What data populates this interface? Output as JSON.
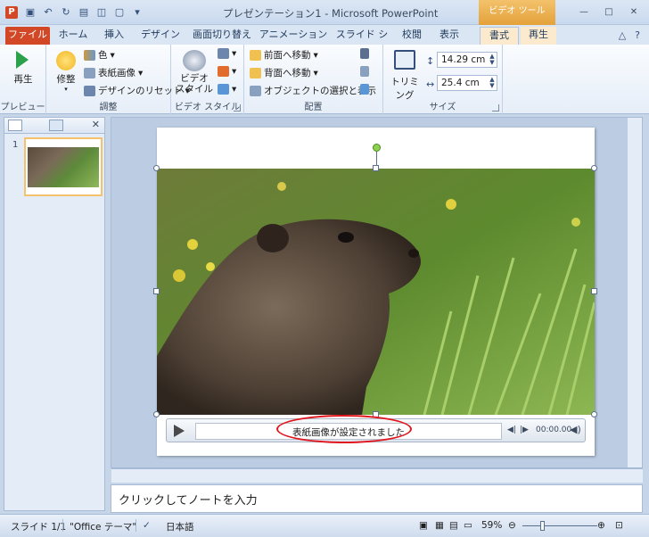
{
  "window": {
    "title": "プレゼンテーション1 - Microsoft PowerPoint",
    "app_icon_letter": "P",
    "context_tool": "ビデオ ツール",
    "controls": [
      "—",
      "□",
      "✕"
    ]
  },
  "qat_icons": [
    "save-icon",
    "undo-icon",
    "redo-icon",
    "open-icon",
    "print-preview-icon",
    "new-icon",
    "customize-icon"
  ],
  "tabs": [
    {
      "label": "ファイル"
    },
    {
      "label": "ホーム"
    },
    {
      "label": "挿入"
    },
    {
      "label": "デザイン"
    },
    {
      "label": "画面切り替え"
    },
    {
      "label": "アニメーション"
    },
    {
      "label": "スライド ショー"
    },
    {
      "label": "校閲"
    },
    {
      "label": "表示"
    },
    {
      "label": "書式"
    },
    {
      "label": "再生"
    }
  ],
  "ribbon": {
    "groups": {
      "preview": {
        "label": "プレビュー",
        "play": "再生"
      },
      "adjust": {
        "label": "調整",
        "correct": "修整",
        "color": "色",
        "poster": "表紙画像",
        "reset": "デザインのリセット"
      },
      "video_style": {
        "label": "ビデオ スタイル",
        "styles": "ビデオ スタイル"
      },
      "arrange": {
        "label": "配置",
        "forward": "前面へ移動",
        "backward": "背面へ移動",
        "selection": "オブジェクトの選択と表示"
      },
      "size": {
        "label": "サイズ",
        "crop": "トリミング",
        "height": "14.29 cm",
        "width": "25.4 cm"
      }
    }
  },
  "slides_pane": {
    "slide_number": "1"
  },
  "player": {
    "status": "表紙画像が設定されました",
    "time": "00:00.00"
  },
  "notes": {
    "placeholder": "クリックしてノートを入力"
  },
  "statusbar": {
    "slide": "スライド 1/1",
    "theme": "\"Office テーマ\"",
    "language": "日本語",
    "zoom": "59%"
  }
}
